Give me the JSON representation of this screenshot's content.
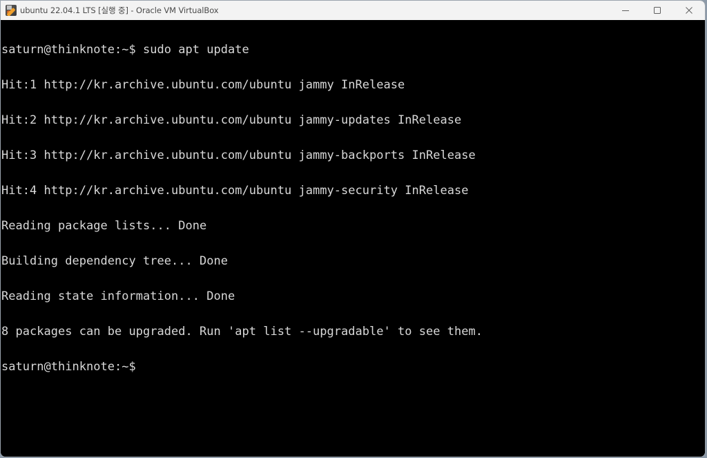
{
  "window": {
    "title": "ubuntu 22.04.1 LTS [실행 중] - Oracle VM VirtualBox",
    "app_icon": "virtualbox-icon",
    "controls": {
      "minimize": "minimize-icon",
      "maximize": "maximize-icon",
      "close": "close-icon"
    }
  },
  "terminal": {
    "lines": [
      "saturn@thinknote:~$ sudo apt update",
      "Hit:1 http://kr.archive.ubuntu.com/ubuntu jammy InRelease",
      "Hit:2 http://kr.archive.ubuntu.com/ubuntu jammy-updates InRelease",
      "Hit:3 http://kr.archive.ubuntu.com/ubuntu jammy-backports InRelease",
      "Hit:4 http://kr.archive.ubuntu.com/ubuntu jammy-security InRelease",
      "Reading package lists... Done",
      "Building dependency tree... Done",
      "Reading state information... Done",
      "8 packages can be upgraded. Run 'apt list --upgradable' to see them.",
      "saturn@thinknote:~$"
    ]
  },
  "colors": {
    "terminal_bg": "#000000",
    "terminal_fg": "#d8d8d8",
    "titlebar_bg": "#f3f3f3"
  }
}
